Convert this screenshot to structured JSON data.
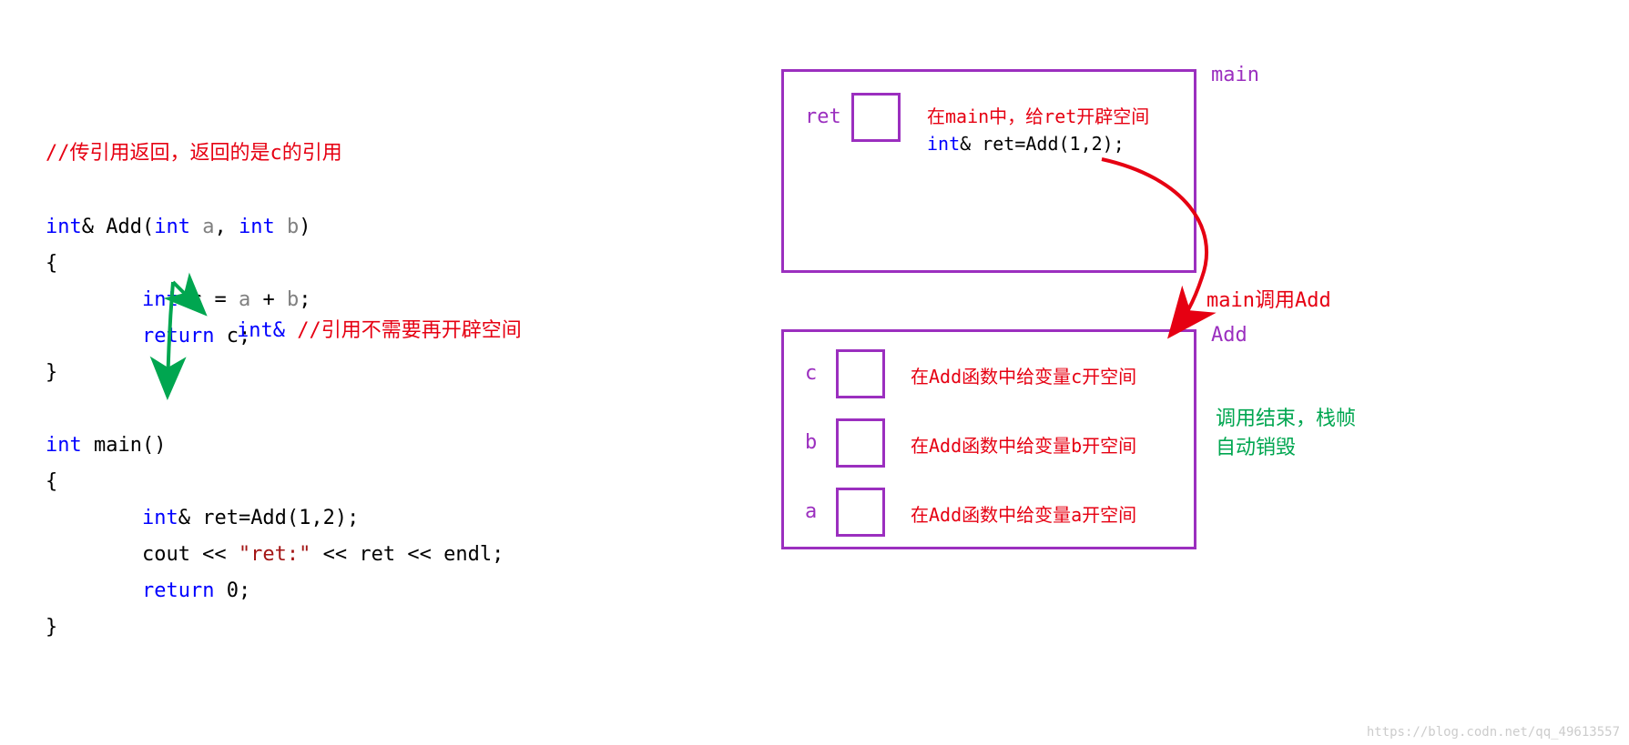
{
  "comment_top": "//传引用返回，返回的是c的引用",
  "code": {
    "l1": "int& Add(int a, int b)",
    "l2": "{",
    "l3": "        int c = a + b;",
    "l4": "        return c;",
    "l5": "}",
    "l6": "",
    "l7": "int main()",
    "l8": "{",
    "l9": "        int& ret=Add(1,2);",
    "l10": "        cout << \"ret:\" << ret << endl;",
    "l11": "        return 0;",
    "l12": "}"
  },
  "mid_annotation": {
    "blue": "int&",
    "red": "   //引用不需要再开辟空间"
  },
  "labels": {
    "main": "main",
    "add": "Add",
    "call": "main调用Add"
  },
  "main_frame": {
    "var": "ret",
    "ann_red": "在main中，给ret开辟空间",
    "ann_code": "int& ret=Add(1,2);"
  },
  "add_frame": {
    "c": {
      "var": "c",
      "ann": "在Add函数中给变量c开空间"
    },
    "b": {
      "var": "b",
      "ann": "在Add函数中给变量b开空间"
    },
    "a": {
      "var": "a",
      "ann": "在Add函数中给变量a开空间"
    }
  },
  "end_call": "调用结束，栈帧\n自动销毁",
  "watermark": "https://blog.codn.net/qq_49613557"
}
